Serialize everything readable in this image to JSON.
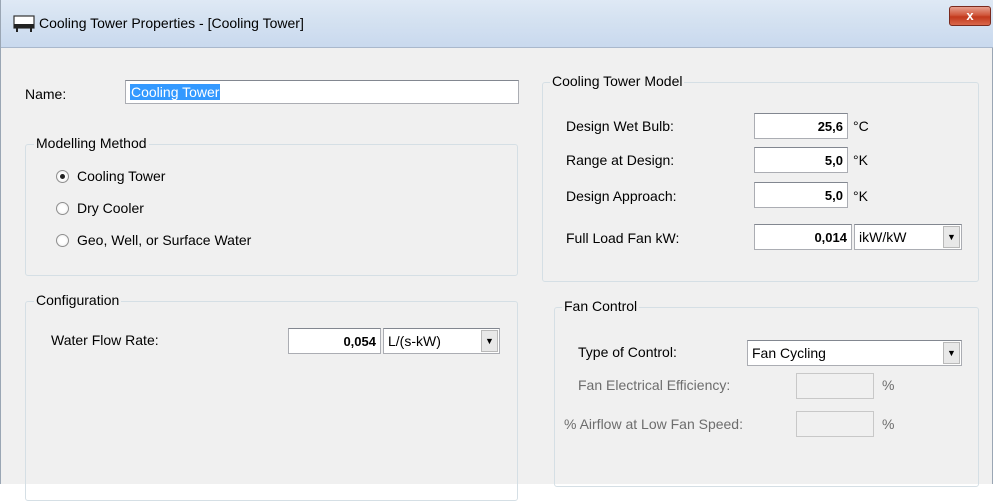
{
  "window": {
    "title": "Cooling Tower Properties - [Cooling Tower]",
    "close_glyph": "x"
  },
  "name_field": {
    "label": "Name:",
    "value": "Cooling Tower"
  },
  "modelling_method": {
    "legend": "Modelling Method",
    "options": [
      {
        "label": "Cooling Tower",
        "checked": true
      },
      {
        "label": "Dry Cooler",
        "checked": false
      },
      {
        "label": "Geo, Well, or Surface Water",
        "checked": false
      }
    ]
  },
  "configuration": {
    "legend": "Configuration",
    "water_flow": {
      "label": "Water Flow Rate:",
      "value": "0,054",
      "unit": "L/(s-kW)"
    }
  },
  "tower_model": {
    "legend": "Cooling Tower Model",
    "rows": [
      {
        "label": "Design Wet Bulb:",
        "value": "25,6",
        "unit": "°C"
      },
      {
        "label": "Range at Design:",
        "value": "5,0",
        "unit": "°K"
      },
      {
        "label": "Design Approach:",
        "value": "5,0",
        "unit": "°K"
      },
      {
        "label": "Full Load Fan kW:",
        "value": "0,014",
        "unit": "ikW/kW"
      }
    ]
  },
  "fan_control": {
    "legend": "Fan Control",
    "type_label": "Type of Control:",
    "type_value": "Fan Cycling",
    "efficiency_label": "Fan Electrical Efficiency:",
    "efficiency_unit": "%",
    "airflow_label": "% Airflow at Low Fan Speed:",
    "airflow_unit": "%"
  },
  "colors": {
    "titlebar": "#d5e2f1",
    "close_button": "#c94a2f",
    "selection": "#3399ff",
    "dialog_bg": "#f0f0f0"
  },
  "icons": {
    "title": "cooling-tower-app-icon",
    "dropdown": "chevron-down-icon"
  }
}
